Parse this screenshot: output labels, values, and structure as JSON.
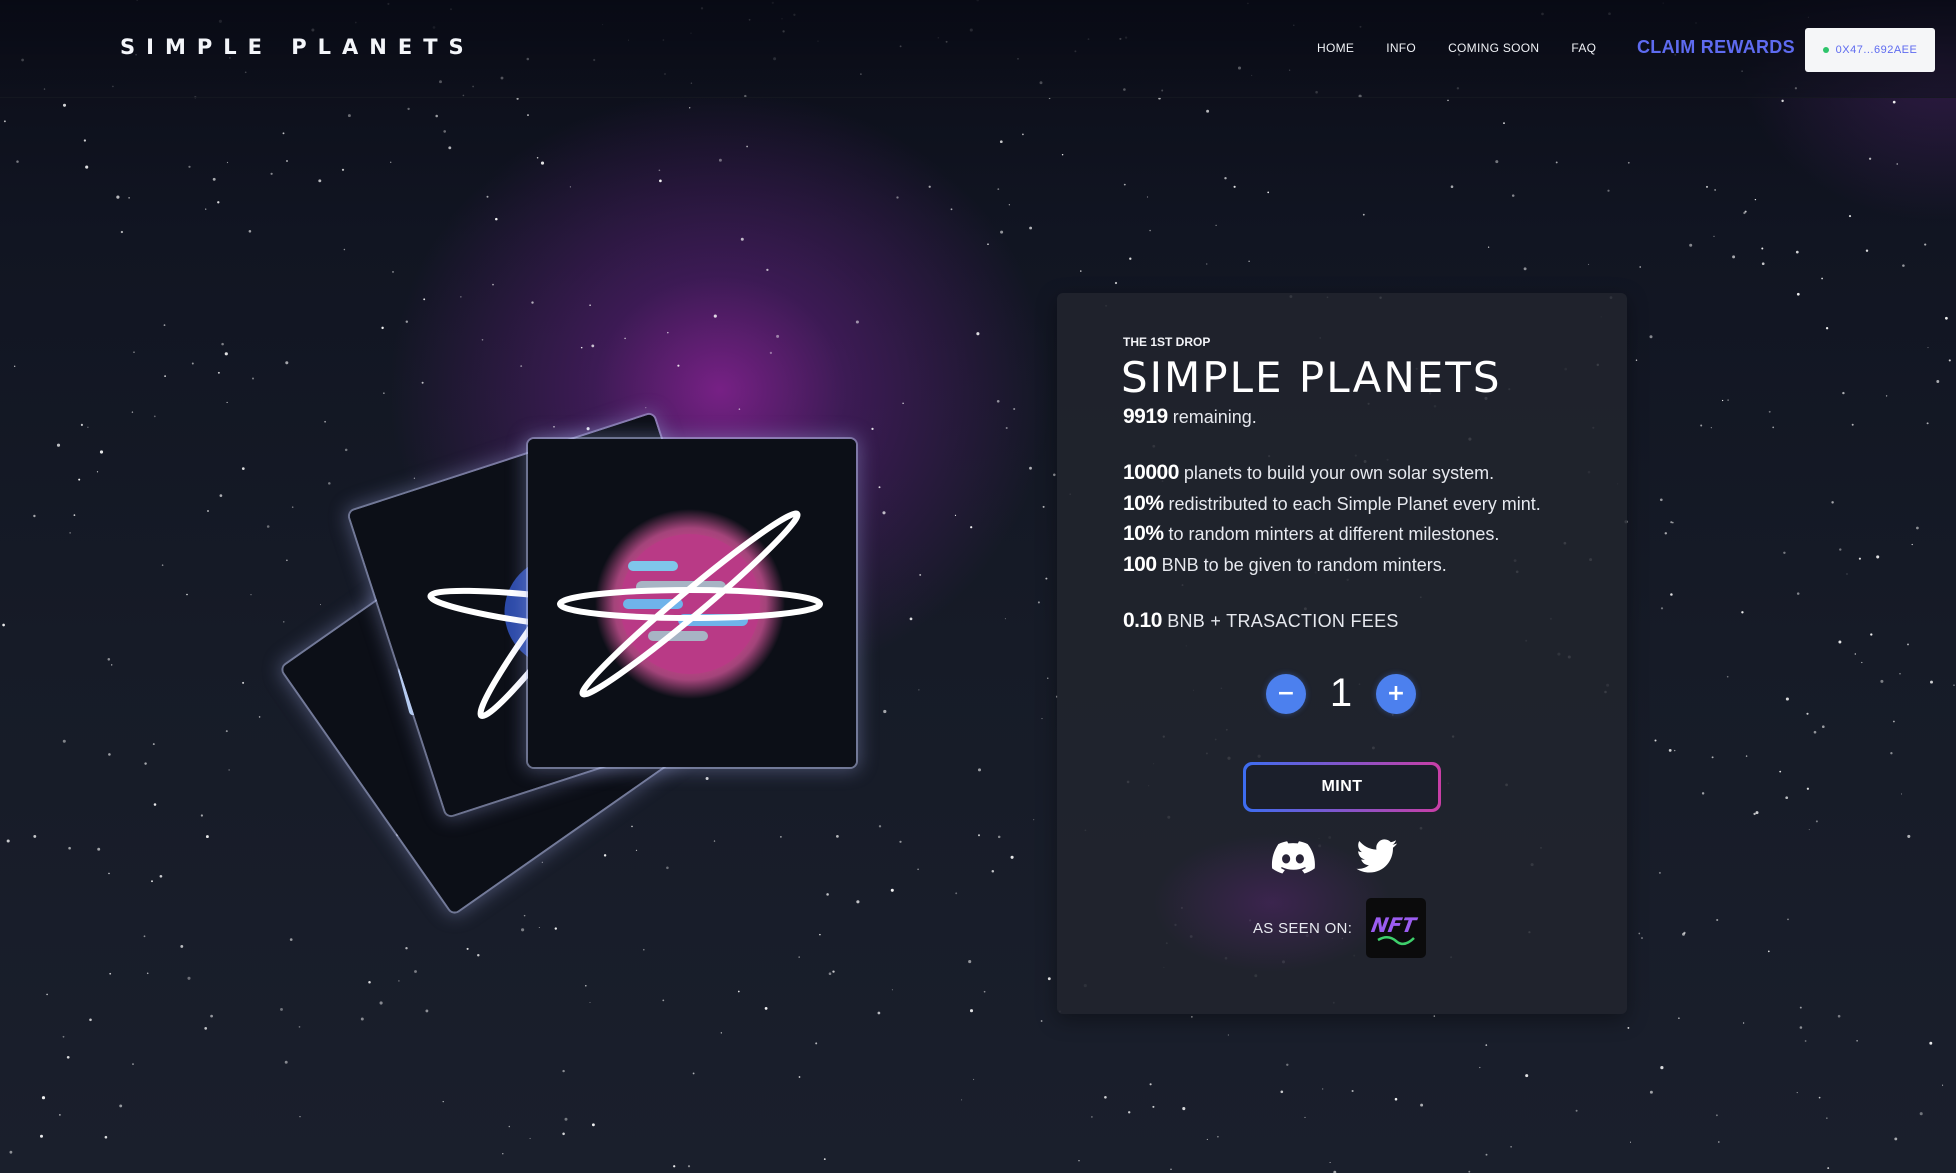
{
  "header": {
    "logo": "SIMPLE PLANETS",
    "nav": [
      "HOME",
      "INFO",
      "COMING SOON",
      "FAQ"
    ],
    "claim_label": "CLAIM REWARDS",
    "wallet_address": "0X47...692AEE",
    "wallet_status_color": "#2ec46b"
  },
  "mint_panel": {
    "drop_label": "THE 1ST DROP",
    "title": "SIMPLE PLANETS",
    "remaining_count": "9919",
    "remaining_text": "remaining.",
    "facts": [
      {
        "value": "10000",
        "text": "planets to build your own solar system."
      },
      {
        "value": "10%",
        "text": "redistributed to each Simple Planet every mint."
      },
      {
        "value": "10%",
        "text": "to random minters at different milestones."
      },
      {
        "value": "100",
        "text": "BNB to be given to random minters."
      }
    ],
    "price_value": "0.10",
    "price_text": "BNB + TRASACTION FEES",
    "quantity": "1",
    "decrement_symbol": "−",
    "increment_symbol": "+",
    "mint_label": "MINT",
    "as_seen_on_label": "AS SEEN ON:",
    "as_seen_on_logo_text": "NFT"
  },
  "colors": {
    "accent": "#5e6bf0",
    "button_blue": "#4c80ee",
    "mint_gradient_start": "#3c6df0",
    "mint_gradient_end": "#c93ea6",
    "nebula": "#882296"
  },
  "icons": {
    "discord": "discord-icon",
    "twitter": "twitter-icon",
    "status_dot": "status-dot-icon"
  }
}
